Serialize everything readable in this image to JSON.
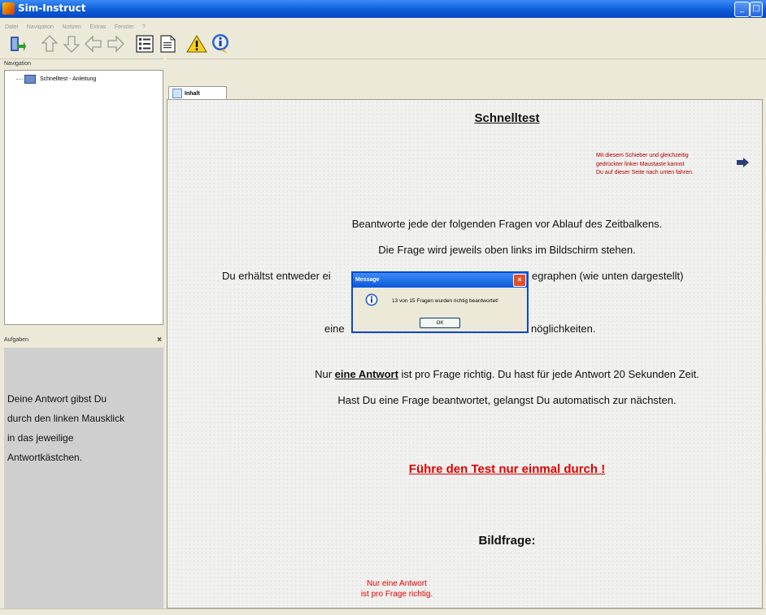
{
  "window": {
    "title": "Sim-Instruct"
  },
  "menu": [
    "Datei",
    "Navigation",
    "Notizen",
    "Extras",
    "Fenster",
    "?"
  ],
  "toolbar": {
    "icons": [
      "exit-icon",
      "arrow-up-icon",
      "arrow-down-icon",
      "arrow-left-icon",
      "arrow-right-icon",
      "list-icon",
      "document-icon",
      "warning-icon",
      "info-icon"
    ]
  },
  "navigation": {
    "header": "Navigation",
    "items": [
      {
        "label": "Schnelltest - Anleitung"
      }
    ]
  },
  "tasks": {
    "header": "Aufgaben",
    "close": "×",
    "lines": [
      "Deine Antwort gibst Du",
      "durch den linken Mausklick",
      "in das jeweilige",
      "Antwortkästchen."
    ]
  },
  "tab": {
    "label": "Inhalt"
  },
  "content": {
    "heading": "Schnelltest",
    "hint": [
      "Mit diesem Schieber und gleichzeitig",
      "gedrückter linker Maustaste kannst",
      "Du auf dieser Seite nach unten fahren."
    ],
    "line1": "Beantworte jede der folgenden Fragen vor Ablauf des Zeitbalkens.",
    "line2": "Die Frage wird jeweils oben links im Bildschirm stehen.",
    "line3a": "Du erhältst entweder ei",
    "line3b": "egraphen (wie unten dargestellt)",
    "line4a": "eine",
    "line4b": "nöglichkeiten.",
    "line5_pre": "Nur ",
    "line5_bold": "eine Antwort",
    "line5_post": " ist pro Frage richtig. Du hast für jede Antwort 20 Sekunden Zeit.",
    "line6": "Hast Du eine Frage beantwortet, gelangst Du automatisch zur nächsten.",
    "warning": "Führe den Test nur einmal durch !",
    "bildfrage": "Bildfrage:",
    "red_small": [
      "Nur eine Antwort",
      "ist pro Frage richtig."
    ]
  },
  "dialog": {
    "title": "Message",
    "message": "13 von 15 Fragen wurden richtig beantwortet!",
    "ok": "OK",
    "close": "×"
  },
  "window_buttons": [
    "_",
    "□"
  ]
}
